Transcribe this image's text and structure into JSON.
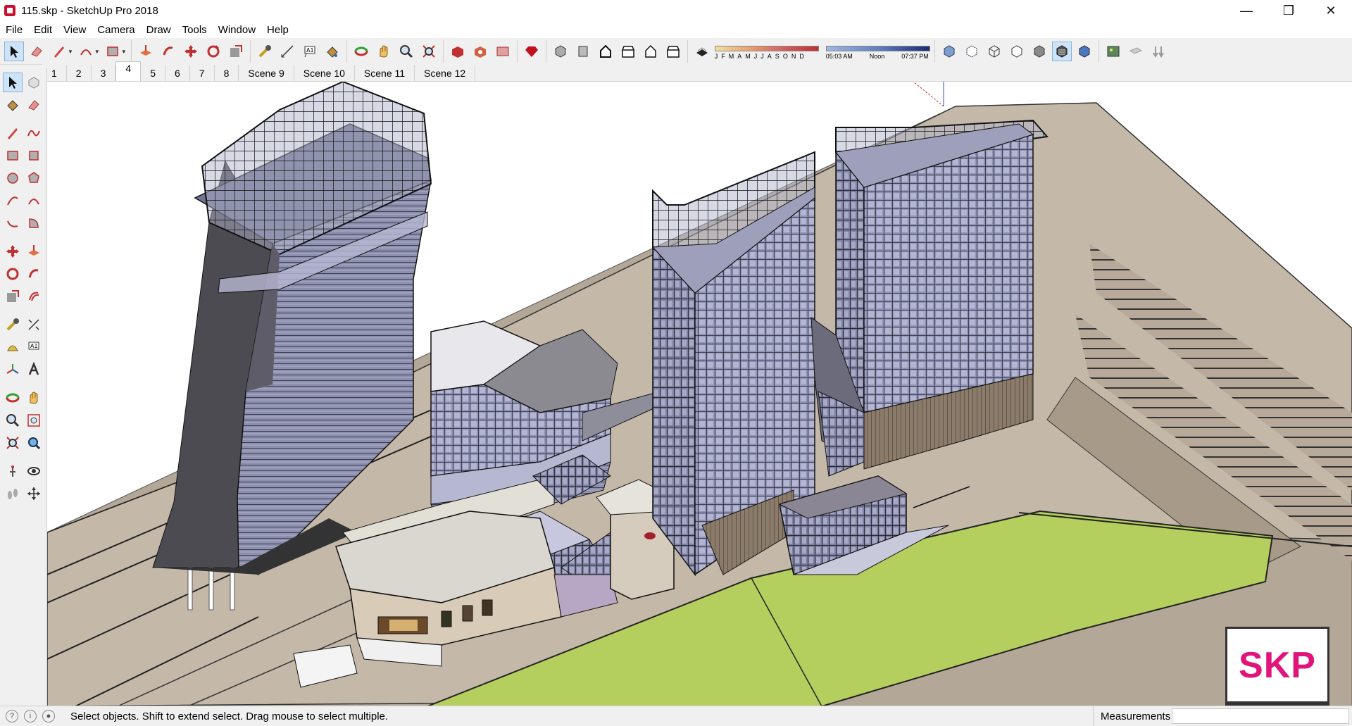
{
  "window": {
    "title": "115.skp - SketchUp Pro 2018",
    "minimize": "—",
    "restore": "❐",
    "close": "✕"
  },
  "menu": [
    "File",
    "Edit",
    "View",
    "Camera",
    "Draw",
    "Tools",
    "Window",
    "Help"
  ],
  "shadows": {
    "months": [
      "J",
      "F",
      "M",
      "A",
      "M",
      "J",
      "J",
      "A",
      "S",
      "O",
      "N",
      "D"
    ],
    "time_start": "05:03 AM",
    "time_mid": "Noon",
    "time_end": "07:37 PM"
  },
  "scenes": [
    "1",
    "2",
    "3",
    "4",
    "5",
    "6",
    "7",
    "8",
    "Scene 9",
    "Scene 10",
    "Scene 11",
    "Scene 12"
  ],
  "active_scene": "4",
  "badge": {
    "text": "SKP",
    "color": "#e0147a"
  },
  "status": {
    "message": "Select objects. Shift to extend select. Drag mouse to select multiple.",
    "measurements_label": "Measurements",
    "measurements_value": ""
  },
  "toolbar_icons": [
    "select-icon",
    "eraser-icon",
    "pencil-icon",
    "arc-icon",
    "rectangle-icon",
    "push-pull-icon",
    "offset-icon",
    "move-icon",
    "rotate-icon",
    "scale-icon",
    "tape-measure-icon",
    "text-icon",
    "paint-bucket-icon",
    "orbit-icon",
    "pan-icon",
    "zoom-icon",
    "zoom-extents-icon",
    "warehouse-icon",
    "extension-warehouse-icon",
    "layout-icon",
    "ruby-icon",
    "iso-view-icon",
    "front-view-icon",
    "house-view-icon",
    "right-view-icon",
    "top-view-icon",
    "back-view-icon",
    "shadow-toggle-icon",
    "xray-icon",
    "back-edges-icon",
    "wireframe-icon",
    "hidden-line-icon",
    "shaded-icon",
    "shaded-textures-icon",
    "monochrome-icon",
    "match-photo-icon",
    "section-plane-icon",
    "section-display-icon"
  ]
}
